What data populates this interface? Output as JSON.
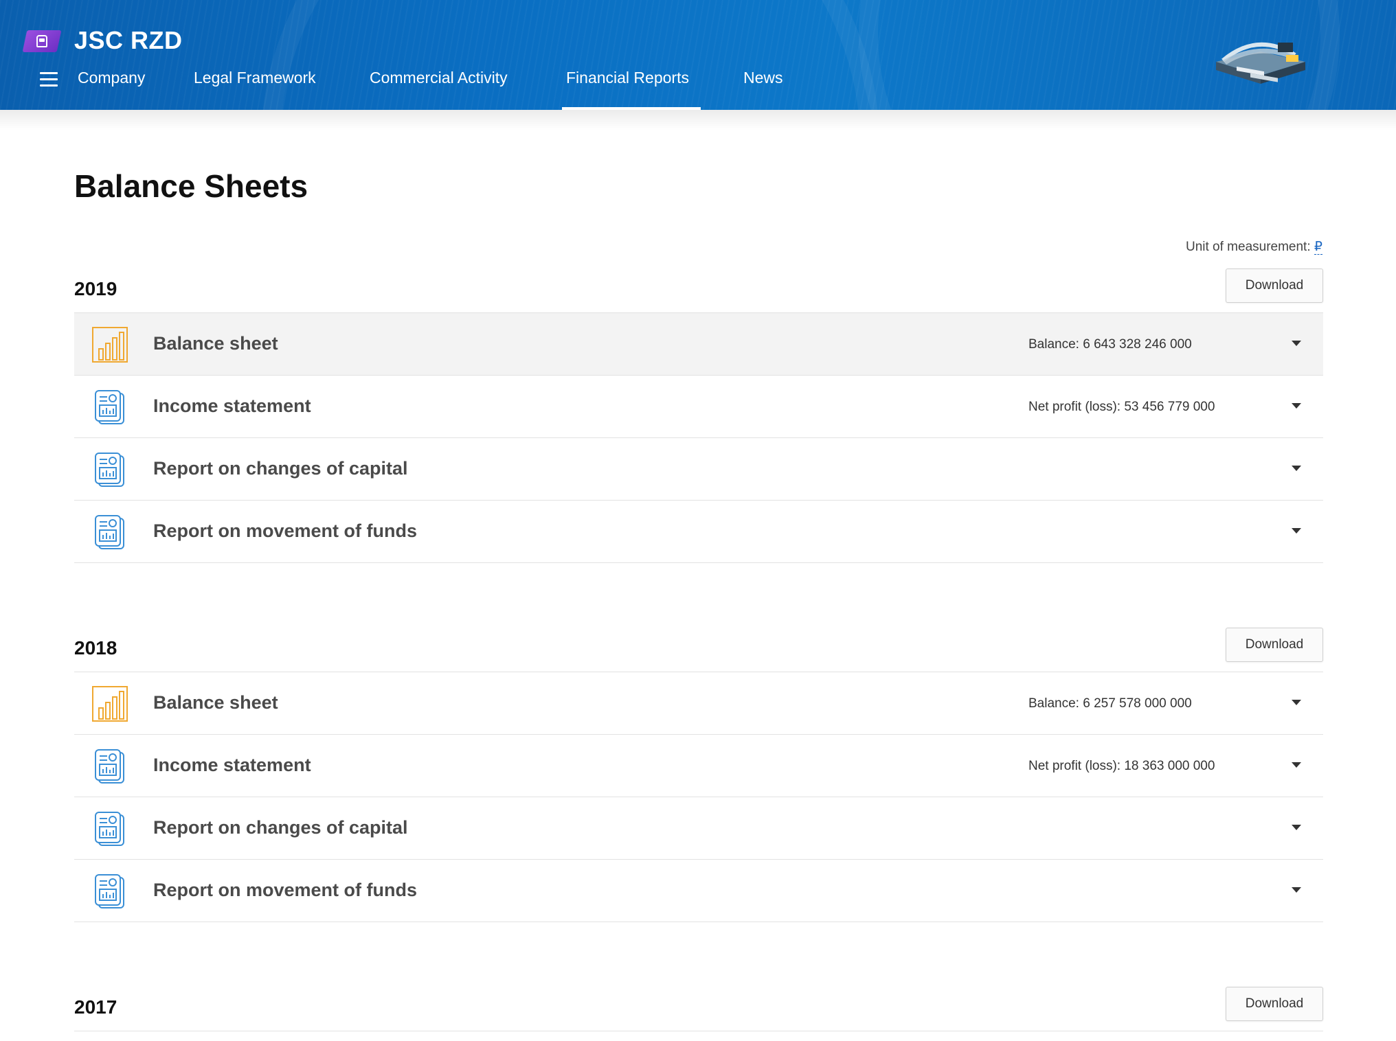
{
  "header": {
    "brand": "JSC RZD",
    "nav": [
      {
        "label": "Company",
        "active": false
      },
      {
        "label": "Legal Framework",
        "active": false
      },
      {
        "label": "Commercial Activity",
        "active": false
      },
      {
        "label": "Financial Reports",
        "active": true
      },
      {
        "label": "News",
        "active": false
      }
    ],
    "colors": {
      "bar": "#0a6ec2",
      "logo": "#8a44d8"
    }
  },
  "main": {
    "title": "Balance Sheets",
    "unit_label": "Unit of measurement:",
    "unit_symbol": "₽",
    "download_label": "Download",
    "years": [
      {
        "year": "2019",
        "rows": [
          {
            "icon": "bar-chart-icon",
            "title": "Balance sheet",
            "value": "Balance: 6 643 328 246 000",
            "highlight": true
          },
          {
            "icon": "report-document-icon",
            "title": "Income statement",
            "value": "Net profit (loss): 53 456 779 000"
          },
          {
            "icon": "report-document-icon",
            "title": "Report on changes of capital",
            "value": ""
          },
          {
            "icon": "report-document-icon",
            "title": "Report on movement of funds",
            "value": ""
          }
        ]
      },
      {
        "year": "2018",
        "rows": [
          {
            "icon": "bar-chart-icon",
            "title": "Balance sheet",
            "value": "Balance: 6 257 578 000 000"
          },
          {
            "icon": "report-document-icon",
            "title": "Income statement",
            "value": "Net profit (loss): 18 363 000 000"
          },
          {
            "icon": "report-document-icon",
            "title": "Report on changes of capital",
            "value": ""
          },
          {
            "icon": "report-document-icon",
            "title": "Report on movement of funds",
            "value": ""
          }
        ]
      },
      {
        "year": "2017",
        "rows": []
      }
    ]
  },
  "colors": {
    "accent_orange": "#f0a830",
    "accent_blue": "#3a8fd6",
    "row_highlight": "#f3f3f3"
  }
}
